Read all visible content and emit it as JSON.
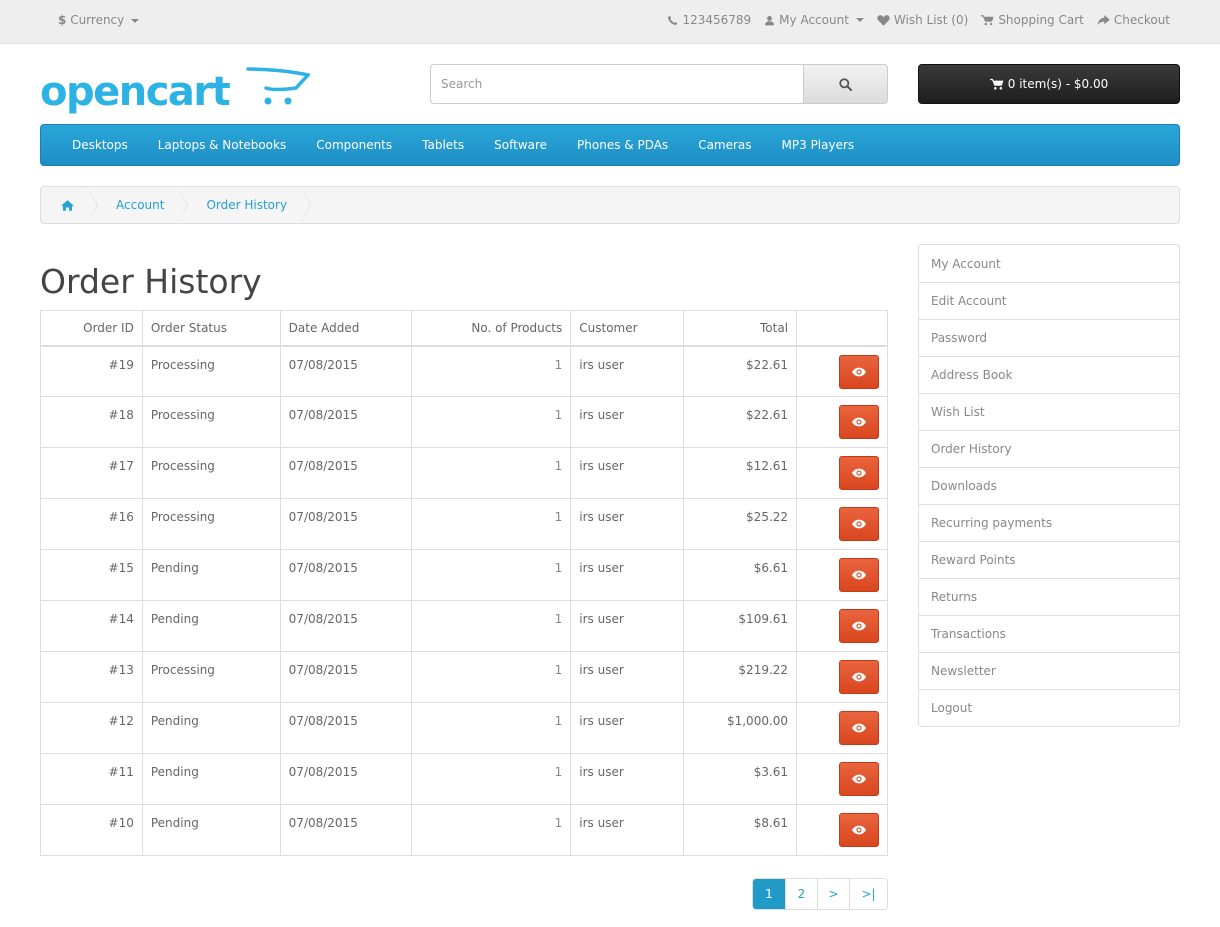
{
  "topbar": {
    "currency_symbol": "$",
    "currency_label": "Currency",
    "phone": "123456789",
    "my_account": "My Account",
    "wish_list": "Wish List (0)",
    "shopping_cart": "Shopping Cart",
    "checkout": "Checkout"
  },
  "header": {
    "logo_text": "opencart",
    "search_placeholder": "Search",
    "search_value": "",
    "cart_label": "0 item(s) - $0.00"
  },
  "menu": [
    "Desktops",
    "Laptops & Notebooks",
    "Components",
    "Tablets",
    "Software",
    "Phones & PDAs",
    "Cameras",
    "MP3 Players"
  ],
  "breadcrumb": [
    "Account",
    "Order History"
  ],
  "page_title": "Order History",
  "table": {
    "headers": [
      "Order ID",
      "Order Status",
      "Date Added",
      "No. of Products",
      "Customer",
      "Total"
    ],
    "rows": [
      {
        "id": "#19",
        "status": "Processing",
        "date": "07/08/2015",
        "qty": "1",
        "customer": "irs user",
        "total": "$22.61"
      },
      {
        "id": "#18",
        "status": "Processing",
        "date": "07/08/2015",
        "qty": "1",
        "customer": "irs user",
        "total": "$22.61"
      },
      {
        "id": "#17",
        "status": "Processing",
        "date": "07/08/2015",
        "qty": "1",
        "customer": "irs user",
        "total": "$12.61"
      },
      {
        "id": "#16",
        "status": "Processing",
        "date": "07/08/2015",
        "qty": "1",
        "customer": "irs user",
        "total": "$25.22"
      },
      {
        "id": "#15",
        "status": "Pending",
        "date": "07/08/2015",
        "qty": "1",
        "customer": "irs user",
        "total": "$6.61"
      },
      {
        "id": "#14",
        "status": "Pending",
        "date": "07/08/2015",
        "qty": "1",
        "customer": "irs user",
        "total": "$109.61"
      },
      {
        "id": "#13",
        "status": "Processing",
        "date": "07/08/2015",
        "qty": "1",
        "customer": "irs user",
        "total": "$219.22"
      },
      {
        "id": "#12",
        "status": "Pending",
        "date": "07/08/2015",
        "qty": "1",
        "customer": "irs user",
        "total": "$1,000.00"
      },
      {
        "id": "#11",
        "status": "Pending",
        "date": "07/08/2015",
        "qty": "1",
        "customer": "irs user",
        "total": "$3.61"
      },
      {
        "id": "#10",
        "status": "Pending",
        "date": "07/08/2015",
        "qty": "1",
        "customer": "irs user",
        "total": "$8.61"
      }
    ]
  },
  "pagination": [
    "1",
    "2",
    ">",
    ">|"
  ],
  "sidebar": [
    "My Account",
    "Edit Account",
    "Password",
    "Address Book",
    "Wish List",
    "Order History",
    "Downloads",
    "Recurring payments",
    "Reward Points",
    "Returns",
    "Transactions",
    "Newsletter",
    "Logout"
  ],
  "colors": {
    "accent": "#23a1d1",
    "menu_bg": "#229ac8",
    "view_button": "#e05a33",
    "cart_button": "#2b2b2b"
  },
  "icons": {
    "phone": "phone-icon",
    "user": "user-icon",
    "heart": "heart-icon",
    "cart": "cart-icon",
    "checkout": "share-icon",
    "search": "search-icon",
    "home": "home-icon",
    "view": "eye-icon"
  }
}
